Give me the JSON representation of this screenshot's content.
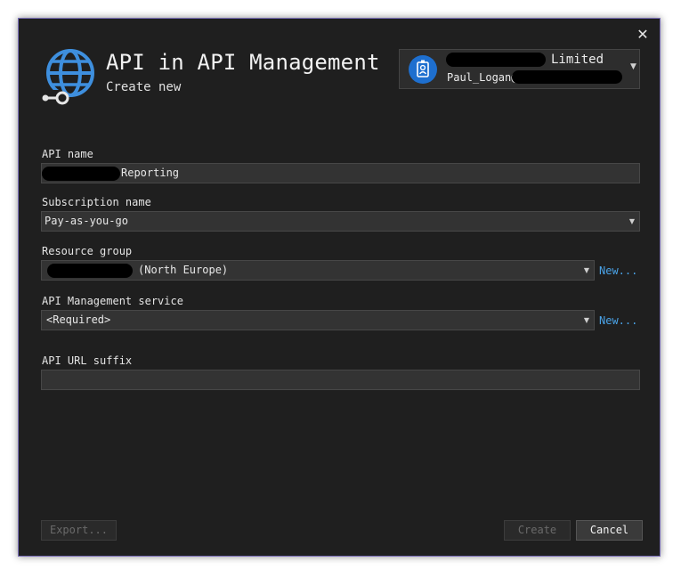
{
  "header": {
    "title": "API in API Management",
    "subtitle": "Create new"
  },
  "account": {
    "tier": "Limited",
    "email_visible": "Paul_Logan@"
  },
  "form": {
    "api_name": {
      "label": "API name",
      "value": "Reporting"
    },
    "subscription": {
      "label": "Subscription name",
      "value": "Pay-as-you-go"
    },
    "resource_group": {
      "label": "Resource group",
      "value": "(North Europe)",
      "new_link": "New..."
    },
    "apim_service": {
      "label": "API Management service",
      "value": "<Required>",
      "new_link": "New..."
    },
    "url_suffix": {
      "label": "API URL suffix",
      "value": ""
    }
  },
  "footer": {
    "export_label": "Export...",
    "create_label": "Create",
    "cancel_label": "Cancel"
  },
  "icons": {
    "close": "close-icon",
    "logo": "globe-api-icon",
    "avatar": "account-avatar-icon",
    "dropdown": "chevron-down-icon"
  },
  "colors": {
    "background": "#1f1f1f",
    "field": "#333333",
    "link": "#4aa3e8",
    "logo": "#3e8fde"
  }
}
